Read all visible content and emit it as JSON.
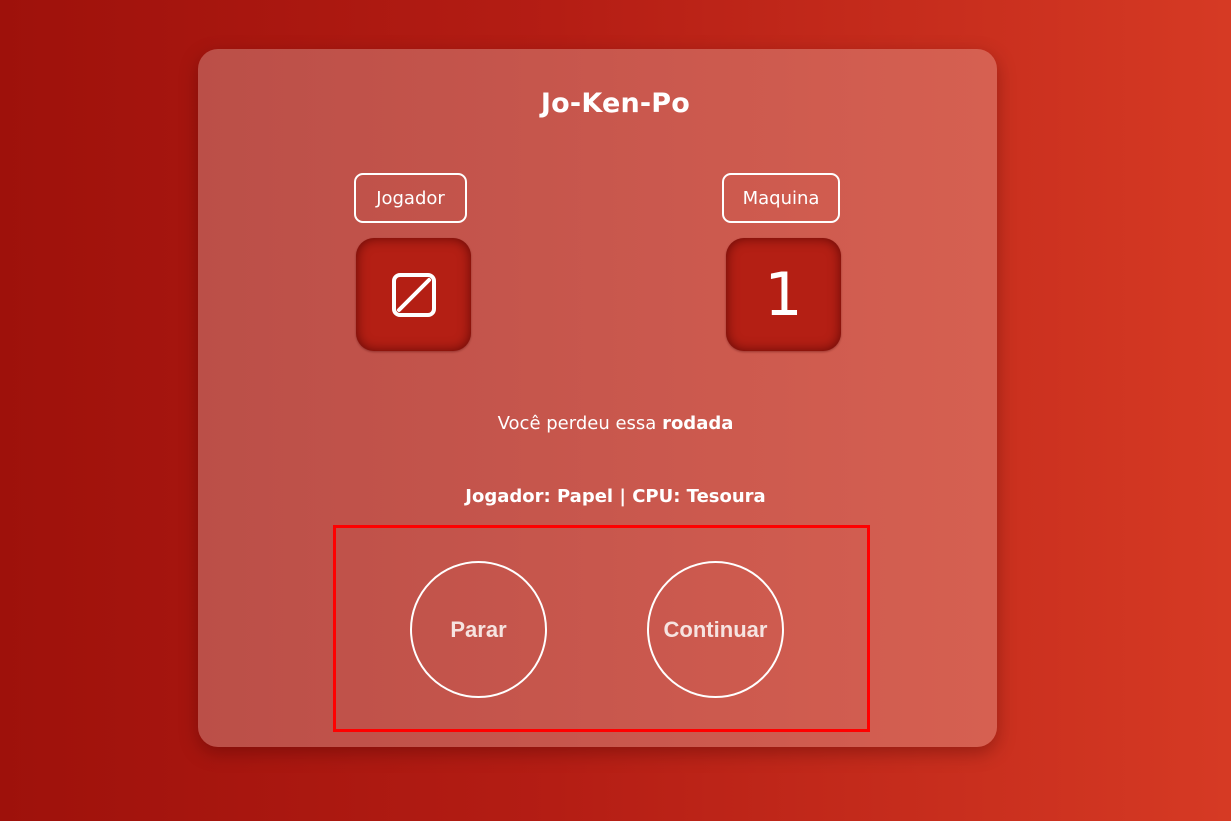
{
  "game": {
    "title": "Jo-Ken-Po"
  },
  "player": {
    "label": "Jogador",
    "choice_icon": "empty-set-icon"
  },
  "cpu": {
    "label": "Maquina",
    "choice_value": "1"
  },
  "result": {
    "prefix": "Você perdeu essa",
    "emphasis": "rodada"
  },
  "score": {
    "text": "Jogador: Papel | CPU: Tesoura"
  },
  "actions": {
    "stop_label": "Parar",
    "continue_label": "Continuar"
  },
  "colors": {
    "background_start": "#9e110b",
    "background_end": "#d63a24",
    "choice_box": "#b41f14",
    "highlight": "#ff0000",
    "text": "#ffffff"
  }
}
